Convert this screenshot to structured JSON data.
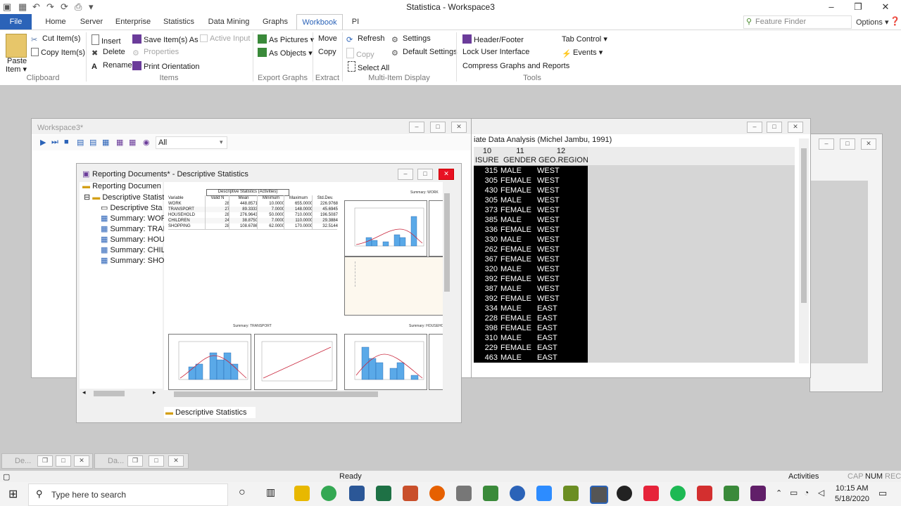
{
  "window": {
    "title": "Statistica - Workspace3"
  },
  "tabs": [
    "File",
    "Home",
    "Server",
    "Enterprise",
    "Statistics",
    "Data Mining",
    "Graphs",
    "Workbook",
    "PI"
  ],
  "feature_finder": {
    "placeholder": "Feature Finder"
  },
  "options_label": "Options",
  "ribbon": {
    "clipboard": {
      "paste": "Paste",
      "paste2": "Item",
      "cut": "Cut Item(s)",
      "copy": "Copy Item(s)",
      "group": "Clipboard"
    },
    "items": {
      "insert": "Insert",
      "delete": "Delete",
      "rename": "Rename",
      "save_as": "Save Item(s) As",
      "properties": "Properties",
      "print_orientation": "Print Orientation",
      "active_input": "Active Input",
      "group": "Items"
    },
    "export": {
      "as_pictures": "As Pictures",
      "as_objects": "As Objects",
      "group": "Export Graphs"
    },
    "extract": {
      "move": "Move",
      "copy": "Copy",
      "group": "Extract"
    },
    "display": {
      "refresh": "Refresh",
      "copy": "Copy",
      "select_all": "Select All",
      "settings": "Settings",
      "default_settings": "Default Settings",
      "group": "Multi-Item Display"
    },
    "tools": {
      "header_footer": "Header/Footer",
      "lock_ui": "Lock User Interface",
      "compress": "Compress Graphs and Reports",
      "tab_control": "Tab Control",
      "events": "Events",
      "group": "Tools"
    }
  },
  "workspace_win": {
    "title": "Workspace3*",
    "filter": "All"
  },
  "report_win": {
    "title": "Reporting Documents* - Descriptive Statistics",
    "tree": [
      "Reporting Documen",
      "Descriptive Statist",
      "Descriptive Sta",
      "Summary: WOR",
      "Summary: TRAI",
      "Summary: HOU",
      "Summary: CHIL",
      "Summary: SHO"
    ],
    "bottom_tab": "Descriptive Statistics",
    "table_title": "Descriptive Statistics (Activities)",
    "table_headers": [
      "Variable",
      "Valid N",
      "Mean",
      "Minimum",
      "Maximum",
      "Std.Dev."
    ],
    "table_rows": [
      [
        "WORK",
        "28",
        "448.8571",
        "10.0000",
        "655.0000",
        "226.9768"
      ],
      [
        "TRANSPORT",
        "27",
        "89.3333",
        "7.0000",
        "148.0000",
        "45.6945"
      ],
      [
        "HOUSEHOLD",
        "28",
        "276.9643",
        "50.0000",
        "710.0000",
        "196.5087"
      ],
      [
        "CHILDREN",
        "24",
        "38.8750",
        "7.0000",
        "110.0000",
        "29.3884"
      ],
      [
        "SHOPPING",
        "28",
        "108.6786",
        "62.0000",
        "170.0000",
        "32.5144"
      ]
    ],
    "summary_work": "Summary: WORK",
    "summary_transport": "Summary: TRANSPORT",
    "summary_household": "Summary: HOUSEHOLD"
  },
  "data_win": {
    "title": "iate Data Analysis (Michel Jambu, 1991)",
    "col_nums": [
      "10",
      "11",
      "12"
    ],
    "col_names": [
      "ISURE",
      "GENDER",
      "GEO.REGION"
    ],
    "rows": [
      [
        "315",
        "MALE",
        "WEST"
      ],
      [
        "305",
        "FEMALE",
        "WEST"
      ],
      [
        "430",
        "FEMALE",
        "WEST"
      ],
      [
        "305",
        "MALE",
        "WEST"
      ],
      [
        "373",
        "FEMALE",
        "WEST"
      ],
      [
        "385",
        "MALE",
        "WEST"
      ],
      [
        "336",
        "FEMALE",
        "WEST"
      ],
      [
        "330",
        "MALE",
        "WEST"
      ],
      [
        "262",
        "FEMALE",
        "WEST"
      ],
      [
        "367",
        "FEMALE",
        "WEST"
      ],
      [
        "320",
        "MALE",
        "WEST"
      ],
      [
        "392",
        "FEMALE",
        "WEST"
      ],
      [
        "387",
        "MALE",
        "WEST"
      ],
      [
        "392",
        "FEMALE",
        "WEST"
      ],
      [
        "334",
        "MALE",
        "EAST"
      ],
      [
        "228",
        "FEMALE",
        "EAST"
      ],
      [
        "398",
        "FEMALE",
        "EAST"
      ],
      [
        "310",
        "MALE",
        "EAST"
      ],
      [
        "229",
        "FEMALE",
        "EAST"
      ],
      [
        "463",
        "MALE",
        "EAST"
      ]
    ]
  },
  "minimized": [
    "De...",
    "Da..."
  ],
  "status": {
    "ready": "Ready",
    "activities": "Activities",
    "cap": "CAP",
    "num": "NUM",
    "rec": "REC"
  },
  "taskbar": {
    "search": "Type here to search",
    "time": "10:15 AM",
    "date": "5/18/2020"
  },
  "colors": {
    "accent": "#2b63b8",
    "grid_bg": "#000000",
    "workspace": "#c9c9c9"
  }
}
